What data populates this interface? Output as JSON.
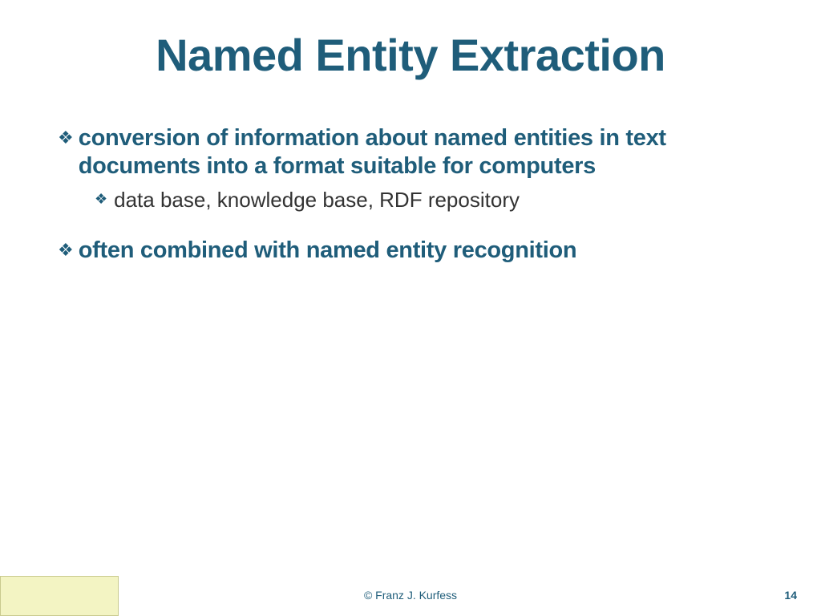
{
  "title": "Named Entity Extraction",
  "bullets": [
    {
      "text": "conversion of information about named entities in text documents into a format suitable for computers",
      "sub": [
        "data base, knowledge base, RDF repository"
      ]
    },
    {
      "text": "often combined with named entity recognition",
      "sub": []
    }
  ],
  "footer": {
    "credit": "© Franz J. Kurfess",
    "page": "14"
  }
}
